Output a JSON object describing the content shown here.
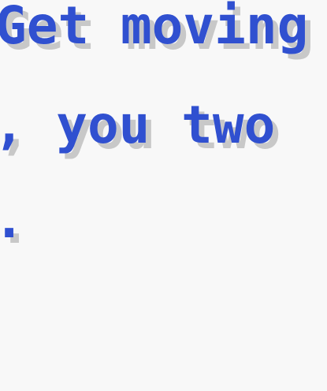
{
  "dialogue": {
    "line1": "Get moving",
    "line2": "g, you two",
    "line3": "o."
  },
  "colors": {
    "background": "#f8f8f8",
    "text": "#3050d0",
    "shadow": "#c8c8c8"
  }
}
